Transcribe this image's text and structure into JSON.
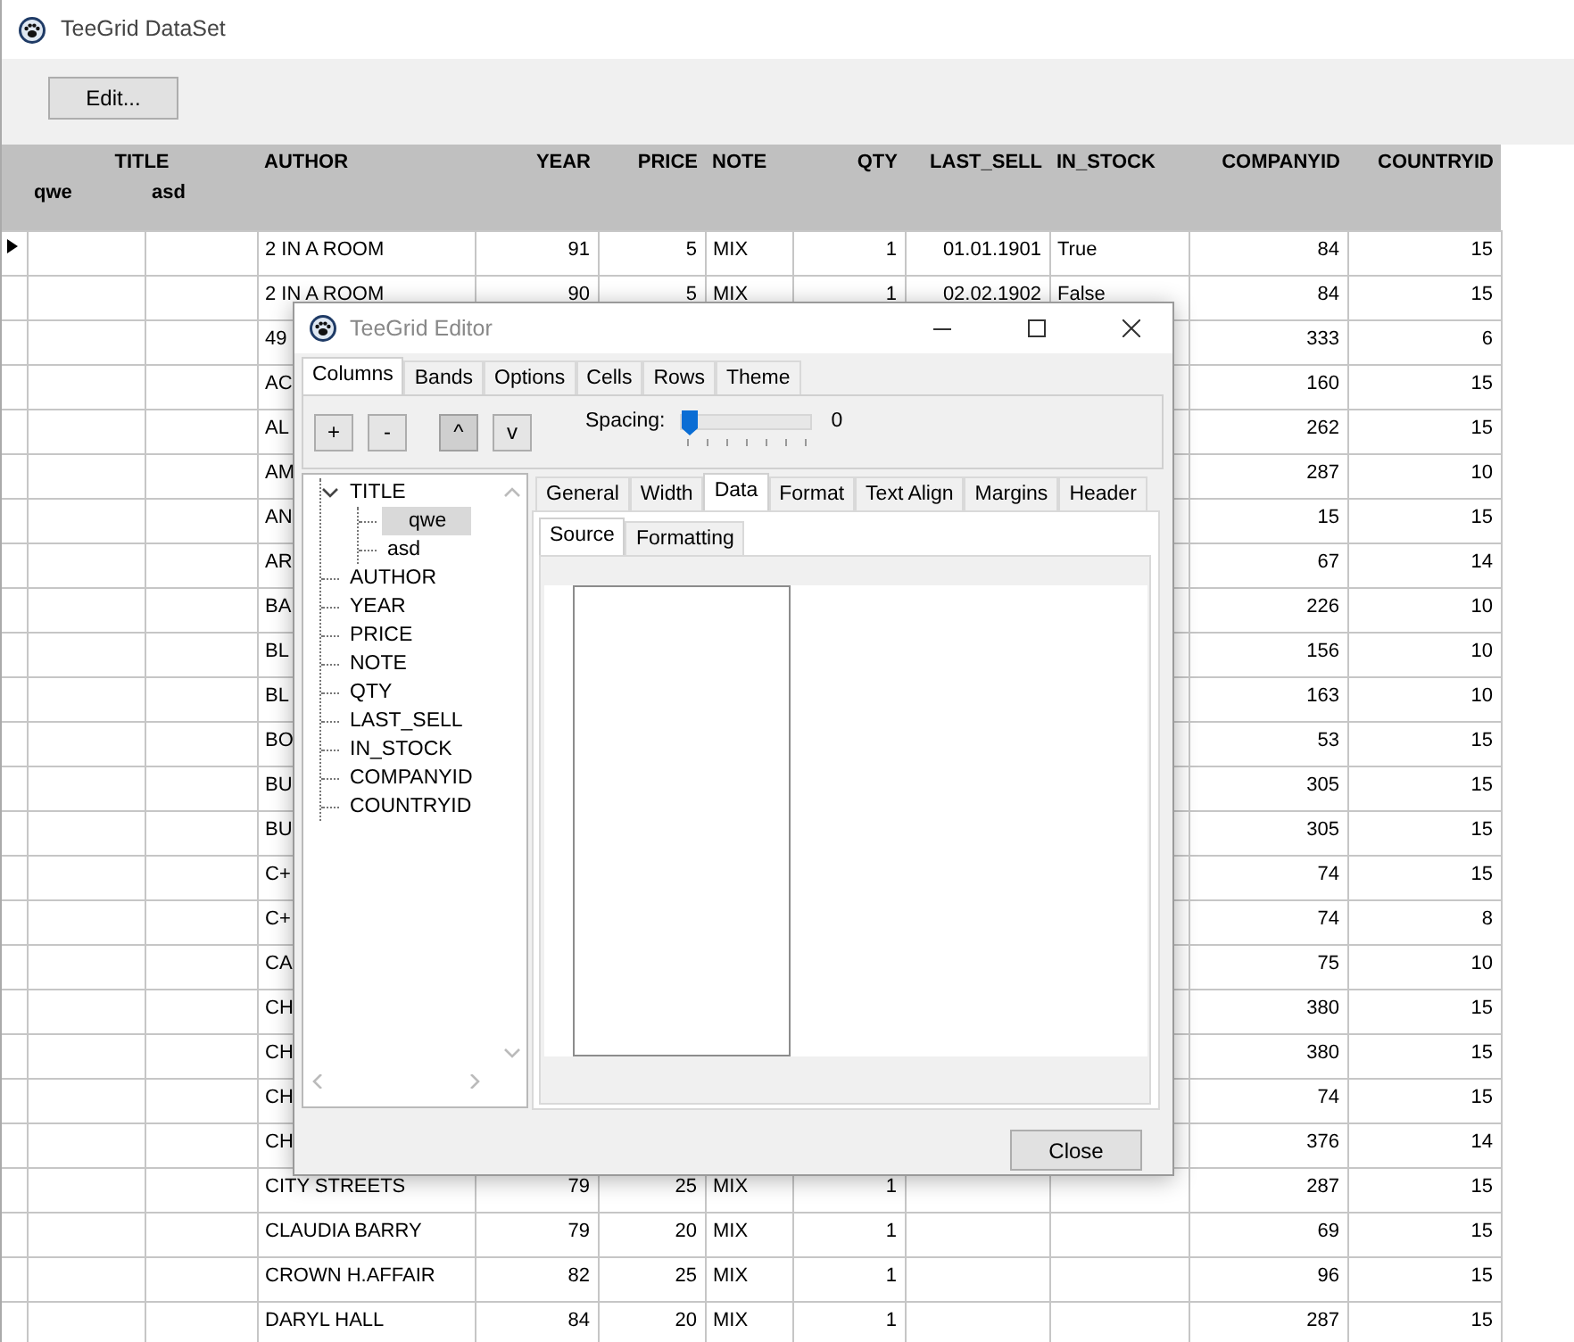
{
  "window": {
    "title": "TeeGrid DataSet"
  },
  "toolbar": {
    "buttons": [
      "Edit..."
    ]
  },
  "grid": {
    "title_group": "TITLE",
    "columns": [
      {
        "label": "qwe",
        "kind": "text",
        "grouped": true
      },
      {
        "label": "asd",
        "kind": "text",
        "grouped": true
      },
      {
        "label": "AUTHOR",
        "kind": "text"
      },
      {
        "label": "YEAR",
        "kind": "number"
      },
      {
        "label": "PRICE",
        "kind": "number"
      },
      {
        "label": "NOTE",
        "kind": "text"
      },
      {
        "label": "QTY",
        "kind": "number"
      },
      {
        "label": "LAST_SELL",
        "kind": "number"
      },
      {
        "label": "IN_STOCK",
        "kind": "text"
      },
      {
        "label": "COMPANYID",
        "kind": "number"
      },
      {
        "label": "COUNTRYID",
        "kind": "number"
      }
    ],
    "rows": [
      {
        "selected": true,
        "cells": [
          null,
          null,
          "2 IN A ROOM",
          "91",
          "5",
          "MIX",
          "1",
          "01.01.1901",
          "True",
          "84",
          "15"
        ]
      },
      {
        "selected": false,
        "cells": [
          null,
          null,
          "2 IN A ROOM",
          "90",
          "5",
          "MIX",
          "1",
          "02.02.1902",
          "False",
          "84",
          "15"
        ]
      },
      {
        "selected": false,
        "cells": [
          null,
          null,
          "49",
          null,
          null,
          null,
          null,
          null,
          null,
          "333",
          "6"
        ]
      },
      {
        "selected": false,
        "cells": [
          null,
          null,
          "AC",
          null,
          null,
          null,
          null,
          null,
          null,
          "160",
          "15"
        ]
      },
      {
        "selected": false,
        "cells": [
          null,
          null,
          "AL",
          null,
          null,
          null,
          null,
          null,
          null,
          "262",
          "15"
        ]
      },
      {
        "selected": false,
        "cells": [
          null,
          null,
          "AM",
          null,
          null,
          null,
          null,
          null,
          null,
          "287",
          "10"
        ]
      },
      {
        "selected": false,
        "cells": [
          null,
          null,
          "AN",
          null,
          null,
          null,
          null,
          null,
          null,
          "15",
          "15"
        ]
      },
      {
        "selected": false,
        "cells": [
          null,
          null,
          "AR",
          null,
          null,
          null,
          null,
          null,
          null,
          "67",
          "14"
        ]
      },
      {
        "selected": false,
        "cells": [
          null,
          null,
          "BA",
          null,
          null,
          null,
          null,
          null,
          null,
          "226",
          "10"
        ]
      },
      {
        "selected": false,
        "cells": [
          null,
          null,
          "BL",
          null,
          null,
          null,
          null,
          null,
          null,
          "156",
          "10"
        ]
      },
      {
        "selected": false,
        "cells": [
          null,
          null,
          "BL",
          null,
          null,
          null,
          null,
          null,
          null,
          "163",
          "10"
        ]
      },
      {
        "selected": false,
        "cells": [
          null,
          null,
          "BO",
          null,
          null,
          null,
          null,
          null,
          null,
          "53",
          "15"
        ]
      },
      {
        "selected": false,
        "cells": [
          null,
          null,
          "BU",
          null,
          null,
          null,
          null,
          null,
          null,
          "305",
          "15"
        ]
      },
      {
        "selected": false,
        "cells": [
          null,
          null,
          "BU",
          null,
          null,
          null,
          null,
          null,
          null,
          "305",
          "15"
        ]
      },
      {
        "selected": false,
        "cells": [
          null,
          null,
          "C+",
          null,
          null,
          null,
          null,
          null,
          null,
          "74",
          "15"
        ]
      },
      {
        "selected": false,
        "cells": [
          null,
          null,
          "C+",
          null,
          null,
          null,
          null,
          null,
          null,
          "74",
          "8"
        ]
      },
      {
        "selected": false,
        "cells": [
          null,
          null,
          "CA",
          null,
          null,
          null,
          null,
          null,
          null,
          "75",
          "10"
        ]
      },
      {
        "selected": false,
        "cells": [
          null,
          null,
          "CH",
          null,
          null,
          null,
          null,
          null,
          null,
          "380",
          "15"
        ]
      },
      {
        "selected": false,
        "cells": [
          null,
          null,
          "CH",
          null,
          null,
          null,
          null,
          null,
          null,
          "380",
          "15"
        ]
      },
      {
        "selected": false,
        "cells": [
          null,
          null,
          "CH",
          null,
          null,
          null,
          null,
          null,
          null,
          "74",
          "15"
        ]
      },
      {
        "selected": false,
        "cells": [
          null,
          null,
          "CH",
          null,
          null,
          null,
          null,
          null,
          null,
          "376",
          "14"
        ]
      },
      {
        "selected": false,
        "cells": [
          null,
          null,
          "CITY STREETS",
          "79",
          "25",
          "MIX",
          "1",
          null,
          null,
          "287",
          "15"
        ]
      },
      {
        "selected": false,
        "cells": [
          null,
          null,
          "CLAUDIA BARRY",
          "79",
          "20",
          "MIX",
          "1",
          null,
          null,
          "69",
          "15"
        ]
      },
      {
        "selected": false,
        "cells": [
          null,
          null,
          "CROWN H.AFFAIR",
          "82",
          "25",
          "MIX",
          "1",
          null,
          null,
          "96",
          "15"
        ]
      },
      {
        "selected": false,
        "cells": [
          null,
          null,
          "DARYL HALL",
          "84",
          "20",
          "MIX",
          "1",
          null,
          null,
          "287",
          "15"
        ]
      }
    ]
  },
  "editor": {
    "title": "TeeGrid Editor",
    "tabs": [
      {
        "label": "Columns",
        "selected": true
      },
      {
        "label": "Bands",
        "selected": false
      },
      {
        "label": "Options",
        "selected": false
      },
      {
        "label": "Cells",
        "selected": false
      },
      {
        "label": "Rows",
        "selected": false
      },
      {
        "label": "Theme",
        "selected": false
      }
    ],
    "column_tools": [
      {
        "label": "+",
        "pressed": false
      },
      {
        "label": "-",
        "pressed": false
      },
      {
        "label": "^",
        "pressed": true
      },
      {
        "label": "v",
        "pressed": false
      }
    ],
    "spacing": {
      "label": "Spacing:",
      "level": 0,
      "reading": "0"
    },
    "tree": [
      {
        "label": "TITLE",
        "expanded": true,
        "selected": false,
        "children": [
          {
            "label": "qwe",
            "selected": true
          },
          {
            "label": "asd",
            "selected": false
          }
        ]
      },
      {
        "label": "AUTHOR",
        "selected": false
      },
      {
        "label": "YEAR",
        "selected": false
      },
      {
        "label": "PRICE",
        "selected": false
      },
      {
        "label": "NOTE",
        "selected": false
      },
      {
        "label": "QTY",
        "selected": false
      },
      {
        "label": "LAST_SELL",
        "selected": false
      },
      {
        "label": "IN_STOCK",
        "selected": false
      },
      {
        "label": "COMPANYID",
        "selected": false
      },
      {
        "label": "COUNTRYID",
        "selected": false
      }
    ],
    "column_tabs": [
      {
        "label": "General",
        "selected": false
      },
      {
        "label": "Width",
        "selected": false
      },
      {
        "label": "Data",
        "selected": true
      },
      {
        "label": "Format",
        "selected": false
      },
      {
        "label": "Text Align",
        "selected": false
      },
      {
        "label": "Margins",
        "selected": false
      },
      {
        "label": "Header",
        "selected": false
      }
    ],
    "data_tabs": [
      {
        "label": "Source",
        "selected": true
      },
      {
        "label": "Formatting",
        "selected": false
      }
    ],
    "close_button": "Close"
  }
}
